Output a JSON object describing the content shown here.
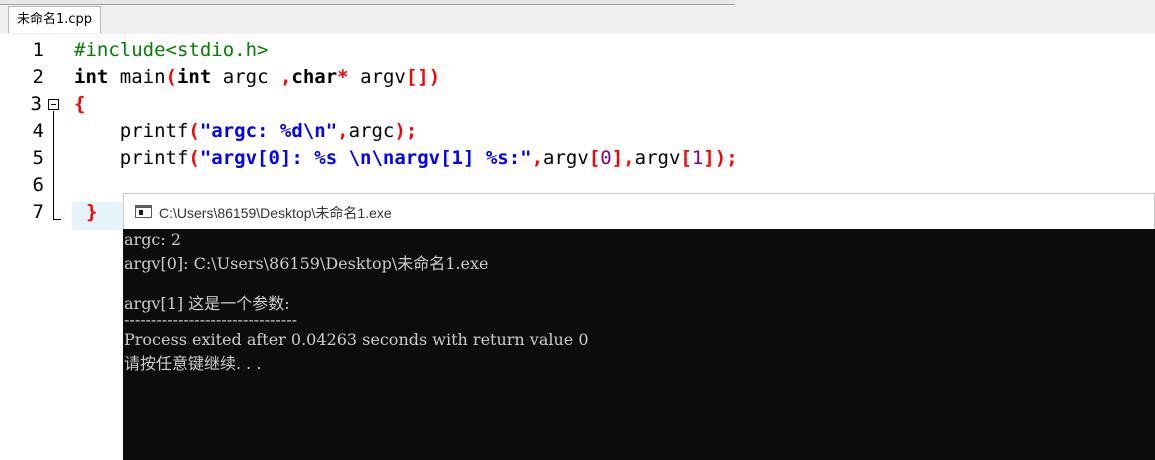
{
  "tab": {
    "label": "未命名1.cpp"
  },
  "editor": {
    "line_numbers": [
      "1",
      "2",
      "3",
      "4",
      "5",
      "6",
      "7"
    ],
    "line1": {
      "directive": "#include<stdio.h>"
    },
    "line2": {
      "kw_int1": "int",
      "main": " main",
      "lparen": "(",
      "kw_int2": "int",
      "argc": " argc ",
      "comma": ",",
      "kw_char": "char",
      "star": "*",
      "argv": " argv",
      "brackets": "[]",
      "rparen": ")"
    },
    "line3": {
      "brace": "{"
    },
    "line4": {
      "indent": "    ",
      "fn": "printf",
      "lparen": "(",
      "str": "\"argc: %d\\n\"",
      "comma": ",",
      "arg": "argc",
      "rparen": ")",
      "semi": ";"
    },
    "line5": {
      "indent": "    ",
      "fn": "printf",
      "lparen": "(",
      "str": "\"argv[0]: %s \\n\\nargv[1] %s:\"",
      "comma1": ",",
      "argv1": "argv",
      "lb1": "[",
      "idx0": "0",
      "rb1": "]",
      "comma2": ",",
      "argv2": "argv",
      "lb2": "[",
      "idx1": "1",
      "rb2": "]",
      "rparen": ")",
      "semi": ";"
    },
    "line7": {
      "brace": "}"
    }
  },
  "console": {
    "title": "C:\\Users\\86159\\Desktop\\未命名1.exe",
    "lines": [
      "argc: 2",
      "argv[0]: C:\\Users\\86159\\Desktop\\未命名1.exe",
      "",
      "argv[1] 这是一个参数:",
      "--------------------------------",
      "Process exited after 0.04263 seconds with return value 0",
      "请按任意键继续. . ."
    ]
  }
}
